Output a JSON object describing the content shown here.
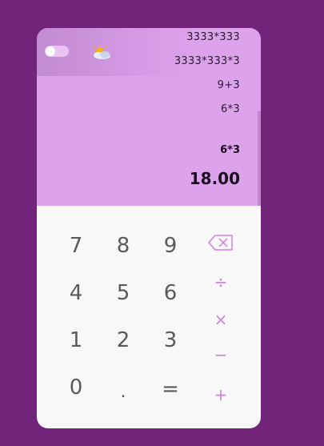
{
  "history": [
    "3333*333",
    "3333*333*3",
    "9+3",
    "6*3"
  ],
  "current_expression": "6*3",
  "result": "18.00",
  "keys": {
    "seven": "7",
    "eight": "8",
    "nine": "9",
    "four": "4",
    "five": "5",
    "six": "6",
    "one": "1",
    "two": "2",
    "three": "3",
    "zero": "0",
    "dot": ".",
    "equals": "="
  },
  "operators": {
    "divide": "÷",
    "multiply": "×",
    "minus": "−",
    "plus": "+"
  },
  "icons": {
    "theme_toggle": "toggle-icon",
    "weather": "weather-icon",
    "backspace": "backspace-icon"
  },
  "colors": {
    "background": "#72247a",
    "display": "#dca2ec",
    "accent": "#cf7fdc",
    "keypad": "#f8f8f8"
  }
}
